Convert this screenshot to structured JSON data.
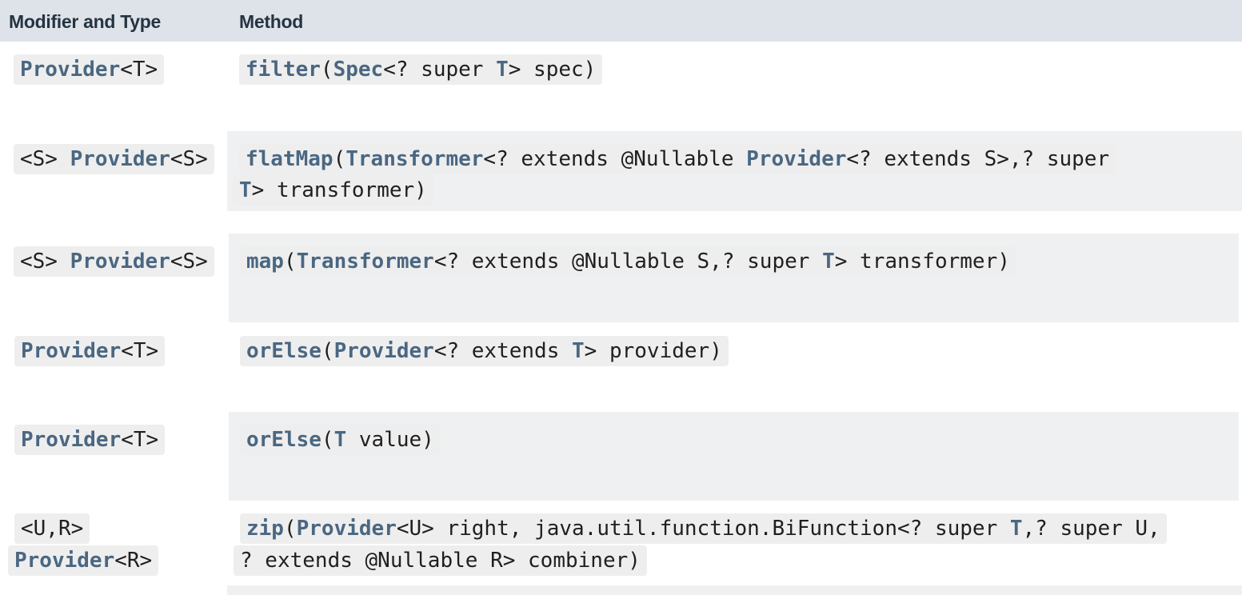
{
  "columns": {
    "modifier": "Modifier and Type",
    "method": "Method"
  },
  "rows": [
    {
      "type_prefix": "",
      "type_link": "Provider",
      "type_suffix": "<T>",
      "method_name": "filter",
      "params": [
        {
          "t": "(",
          "link": false
        },
        {
          "t": "Spec",
          "link": true
        },
        {
          "t": "<? super ",
          "link": false
        },
        {
          "t": "T",
          "link": true
        },
        {
          "t": "> spec)",
          "link": false
        }
      ]
    },
    {
      "type_prefix": "<S> ",
      "type_link": "Provider",
      "type_suffix": "<S>",
      "method_name": "flatMap",
      "params_line1": [
        {
          "t": "(",
          "link": false
        },
        {
          "t": "Transformer",
          "link": true
        },
        {
          "t": "<? extends @Nullable ",
          "link": false
        },
        {
          "t": "Provider",
          "link": true
        },
        {
          "t": "<? extends S>,? super",
          "link": false
        }
      ],
      "params_line2": [
        {
          "t": "T",
          "link": true
        },
        {
          "t": "> transformer)",
          "link": false
        }
      ]
    },
    {
      "type_prefix": "<S> ",
      "type_link": "Provider",
      "type_suffix": "<S>",
      "method_name": "map",
      "params": [
        {
          "t": "(",
          "link": false
        },
        {
          "t": "Transformer",
          "link": true
        },
        {
          "t": "<? extends @Nullable S,? super ",
          "link": false
        },
        {
          "t": "T",
          "link": true
        },
        {
          "t": "> transformer)",
          "link": false
        }
      ]
    },
    {
      "type_prefix": "",
      "type_link": "Provider",
      "type_suffix": "<T>",
      "method_name": "orElse",
      "params": [
        {
          "t": "(",
          "link": false
        },
        {
          "t": "Provider",
          "link": true
        },
        {
          "t": "<? extends ",
          "link": false
        },
        {
          "t": "T",
          "link": true
        },
        {
          "t": "> provider)",
          "link": false
        }
      ]
    },
    {
      "type_prefix": "",
      "type_link": "Provider",
      "type_suffix": "<T>",
      "method_name": "orElse",
      "params": [
        {
          "t": "(",
          "link": false
        },
        {
          "t": "T",
          "link": true
        },
        {
          "t": " value)",
          "link": false
        }
      ]
    },
    {
      "type_prefix": "<U,R>",
      "type_link": "Provider",
      "type_suffix": "<R>",
      "method_name": "zip",
      "params_line1": [
        {
          "t": "(",
          "link": false
        },
        {
          "t": "Provider",
          "link": true
        },
        {
          "t": "<U> right, java.util.function.BiFunction<? super ",
          "link": false
        },
        {
          "t": "T",
          "link": true
        },
        {
          "t": ",? super U,",
          "link": false
        }
      ],
      "params_line2": [
        {
          "t": "? extends @Nullable R> combiner)",
          "link": false
        }
      ]
    }
  ]
}
